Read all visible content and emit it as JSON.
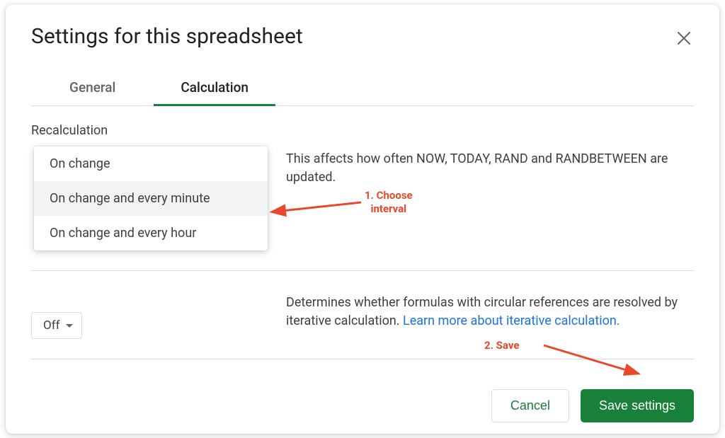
{
  "dialog": {
    "title": "Settings for this spreadsheet"
  },
  "tabs": {
    "general": "General",
    "calculation": "Calculation"
  },
  "recalc": {
    "label": "Recalculation",
    "options": {
      "on_change": "On change",
      "every_minute": "On change and every minute",
      "every_hour": "On change and every hour"
    },
    "description": "This affects how often NOW, TODAY, RAND and RANDBETWEEN are updated."
  },
  "iterative": {
    "selected": "Off",
    "description_prefix": "Determines whether formulas with circular references are resolved by iterative calculation. ",
    "link": "Learn more about iterative calculation."
  },
  "footer": {
    "cancel": "Cancel",
    "save": "Save settings"
  },
  "annotations": {
    "choose_prefix": "1. Choose",
    "choose_suffix": "interval",
    "save": "2. Save"
  },
  "colors": {
    "accent": "#188038",
    "annotation": "#e8492a",
    "link": "#1a73e8"
  }
}
